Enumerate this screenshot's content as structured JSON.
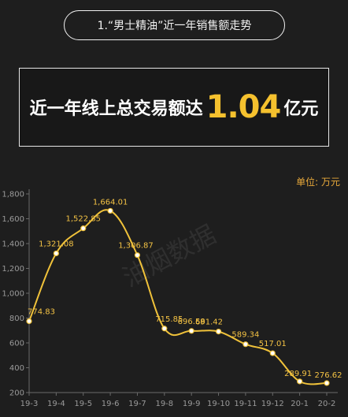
{
  "header": {
    "title": "1.“男士精油”近一年销售额走势"
  },
  "summary": {
    "prefix": "近一年线上总交易额达",
    "value": "1.04",
    "suffix": "亿元"
  },
  "unit_label": "单位: 万元",
  "watermark_text": "油烟数据",
  "colors": {
    "line": "#f0c23a",
    "marker_fill": "#ffffff",
    "value_label": "#f3c244",
    "axis_text": "#9a9a9a",
    "grid": "#3a3a3a"
  },
  "chart_data": {
    "type": "line",
    "x": [
      "19-3",
      "19-4",
      "19-5",
      "19-6",
      "19-7",
      "19-8",
      "19-9",
      "19-10",
      "19-11",
      "19-12",
      "20-1",
      "20-2"
    ],
    "series": [
      {
        "values": [
          774.83,
          1321.08,
          1522.85,
          1664.01,
          1306.87,
          715.85,
          696.58,
          691.42,
          589.34,
          517.01,
          289.91,
          276.62
        ],
        "labels": [
          "774.83",
          "1,321.08",
          "1,522.85",
          "1,664.01",
          "1,306.87",
          "715.85",
          "696.58",
          "691.42",
          "589.34",
          "517.01",
          "289.91",
          "276.62"
        ]
      }
    ],
    "y_ticks": [
      200,
      400,
      600,
      800,
      1000,
      1200,
      1400,
      1600,
      1800
    ],
    "y_tick_labels": [
      "200",
      "400",
      "600",
      "800",
      "1,000",
      "1,200",
      "1,400",
      "1,600",
      "1,800"
    ],
    "ylim": [
      200,
      1800
    ],
    "smooth": true,
    "grid": false
  }
}
